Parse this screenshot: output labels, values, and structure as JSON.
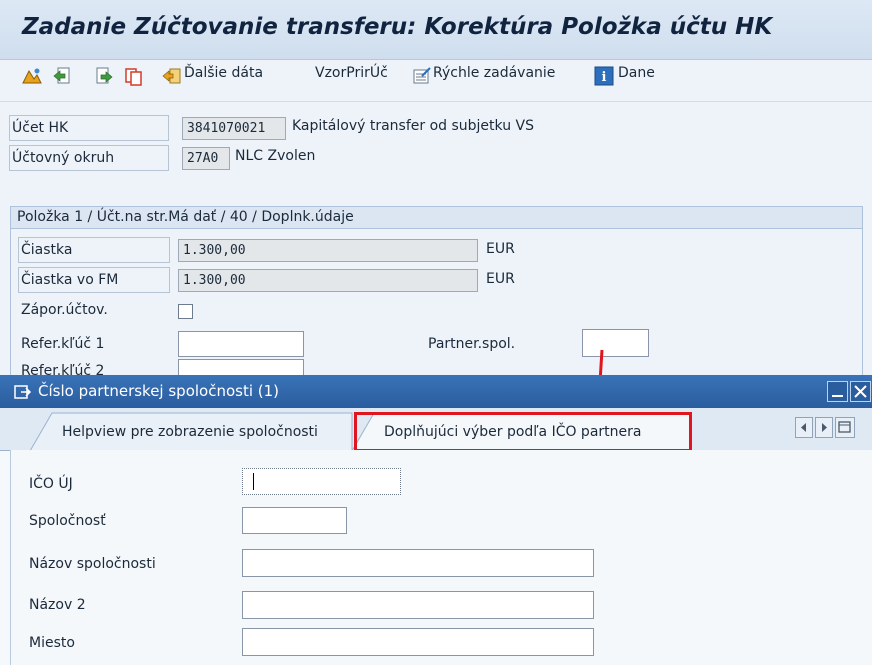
{
  "window": {
    "title": "Zadanie Zúčtovanie transferu: Korektúra Položka účtu HK"
  },
  "toolbar": {
    "icons": [
      "overview-icon",
      "back-doc-icon",
      "next-doc-icon",
      "copy-icon"
    ],
    "dalsie_data": "Ďalšie dáta",
    "vzor": "VzorPrirÚč",
    "rychle": "Rýchle zadávanie",
    "dane": "Dane"
  },
  "header_fields": {
    "ucet_hk_label": "Účet HK",
    "ucet_hk_value": "3841070021",
    "ucet_hk_desc": "Kapitálový transfer od subjetku VS",
    "okruh_label": "Účtovný okruh",
    "okruh_value": "27A0",
    "okruh_desc": "NLC Zvolen"
  },
  "item_group": {
    "title": "Položka 1 / Účt.na str.Má dať / 40 / Doplnk.údaje",
    "ciastka_label": "Čiastka",
    "ciastka_value": "1.300,00",
    "ciastka_currency": "EUR",
    "ciastka_fm_label": "Čiastka vo FM",
    "ciastka_fm_value": "1.300,00",
    "ciastka_fm_currency": "EUR",
    "zapor_label": "Zápor.účtov.",
    "refer1_label": "Refer.kľúč 1",
    "refer2_label": "Refer.kľúč 2",
    "partner_label": "Partner.spol."
  },
  "popup": {
    "title": "Číslo partnerskej spoločnosti (1)",
    "tabs": [
      "Helpview pre zobrazenie spoločnosti",
      "Doplňujúci výber podľa IČO partnera"
    ],
    "fields": {
      "ico_label": "IČO ÚJ",
      "spolocnost_label": "Spoločnosť",
      "nazov_label": "Názov spoločnosti",
      "nazov2_label": "Názov 2",
      "miesto_label": "Miesto"
    }
  },
  "colors": {
    "highlight": "#e0161e",
    "popup_titlebar": "#2f65a8"
  }
}
